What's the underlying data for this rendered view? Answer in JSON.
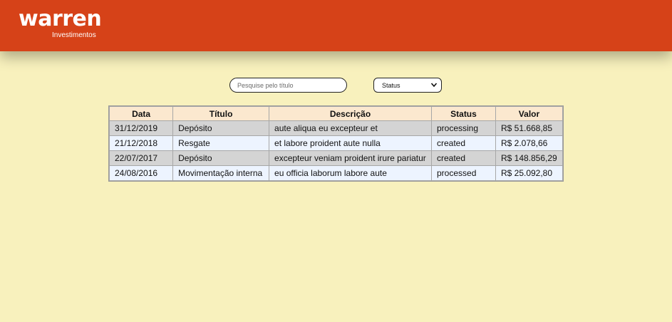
{
  "brand": {
    "logo": "warren",
    "sub": "Investimentos"
  },
  "filters": {
    "search_placeholder": "Pesquise pelo título",
    "status_selected": "Status"
  },
  "table": {
    "headers": [
      "Data",
      "Título",
      "Descrição",
      "Status",
      "Valor"
    ],
    "rows": [
      [
        "31/12/2019",
        "Depósito",
        "aute aliqua eu excepteur et",
        "processing",
        "R$ 51.668,85"
      ],
      [
        "21/12/2018",
        "Resgate",
        "et labore proident aute nulla",
        "created",
        "R$ 2.078,66"
      ],
      [
        "22/07/2017",
        "Depósito",
        "excepteur veniam proident irure pariatur",
        "created",
        "R$ 148.856,29"
      ],
      [
        "24/08/2016",
        "Movimentação interna",
        "eu officia laborum labore aute",
        "processed",
        "R$ 25.092,80"
      ]
    ]
  },
  "colors": {
    "header_bg": "#d64218",
    "page_bg": "#f8f1bd",
    "table_header_bg": "#fbe8cf",
    "row_odd_bg": "#d4d4d4",
    "row_even_bg": "#edf4ff"
  }
}
